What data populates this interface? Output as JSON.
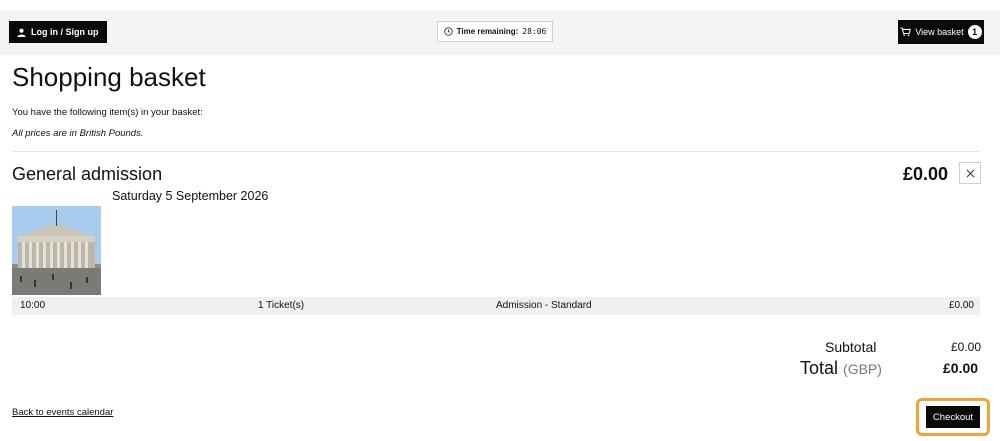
{
  "header": {
    "login_label": "Log in / Sign up",
    "timer_label": "Time remaining:",
    "timer_value": "28:06",
    "basket_label": "View basket",
    "basket_count": "1"
  },
  "page": {
    "title": "Shopping basket",
    "intro": "You have the following item(s) in your basket:",
    "note": "All prices are in British Pounds."
  },
  "item": {
    "title": "General admission",
    "price": "£0.00",
    "date": "Saturday 5 September 2026",
    "details": {
      "time": "10:00",
      "quantity": "1 Ticket(s)",
      "type": "Admission - Standard",
      "price": "£0.00"
    }
  },
  "totals": {
    "subtotal_label": "Subtotal",
    "subtotal_value": "£0.00",
    "total_label": "Total",
    "currency": "(GBP)",
    "total_value": "£0.00"
  },
  "footer": {
    "back_link": "Back to events calendar",
    "checkout_label": "Checkout"
  },
  "colors": {
    "button_bg": "#0a0a0a",
    "highlight": "#f2a23a",
    "topbar_bg": "#f4f4f4"
  },
  "icons": [
    "user-icon",
    "clock-icon",
    "cart-icon",
    "close-icon"
  ]
}
